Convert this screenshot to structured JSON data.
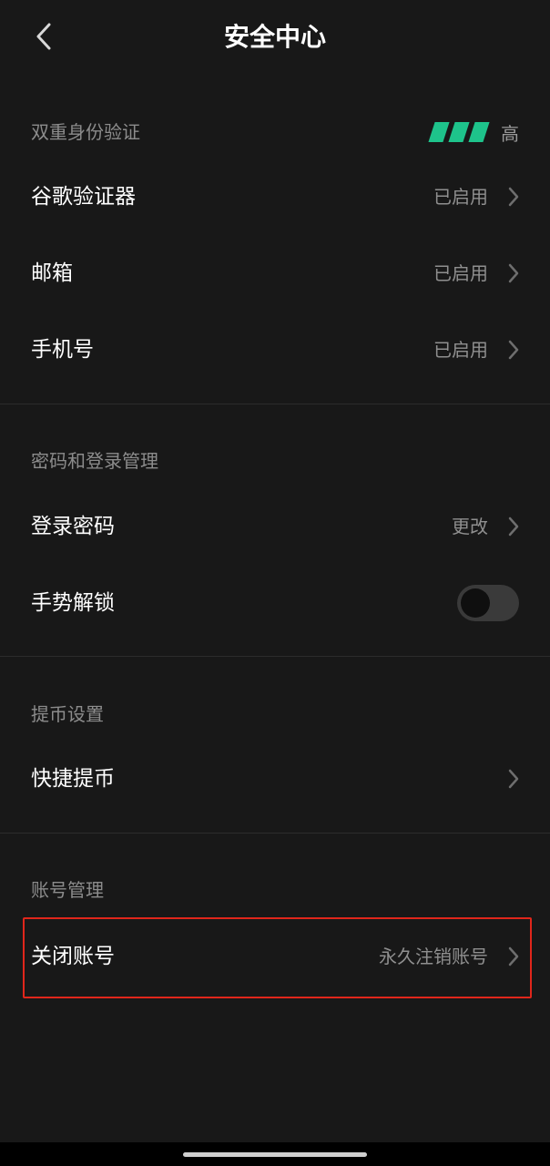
{
  "header": {
    "title": "安全中心"
  },
  "sections": {
    "two_factor": {
      "title": "双重身份验证",
      "strength_label": "高",
      "rows": {
        "google": {
          "label": "谷歌验证器",
          "value": "已启用"
        },
        "email": {
          "label": "邮箱",
          "value": "已启用"
        },
        "phone": {
          "label": "手机号",
          "value": "已启用"
        }
      }
    },
    "password": {
      "title": "密码和登录管理",
      "rows": {
        "login_password": {
          "label": "登录密码",
          "value": "更改"
        },
        "gesture_unlock": {
          "label": "手势解锁",
          "toggle_on": false
        }
      }
    },
    "withdraw": {
      "title": "提币设置",
      "rows": {
        "quick_withdraw": {
          "label": "快捷提币"
        }
      }
    },
    "account": {
      "title": "账号管理",
      "rows": {
        "close_account": {
          "label": "关闭账号",
          "value": "永久注销账号"
        }
      }
    }
  },
  "colors": {
    "background": "#181818",
    "strength_bar": "#1ec38b",
    "highlight_border": "#e0261b"
  },
  "icons": {
    "back": "chevron-left-icon",
    "row_arrow": "chevron-right-icon"
  }
}
